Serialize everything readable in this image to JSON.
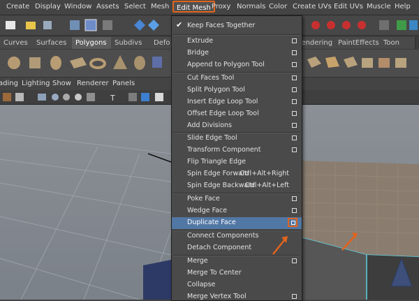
{
  "menubar": [
    "Create",
    "Display",
    "Window",
    "Assets",
    "Select",
    "Mesh",
    "Edit Mesh",
    "Proxy",
    "Normals",
    "Color",
    "Create UVs",
    "Edit UVs",
    "Muscle",
    "Help"
  ],
  "tabs": [
    "Curves",
    "Surfaces",
    "Polygons",
    "Subdivs",
    "Defo",
    "Rendering",
    "PaintEffects",
    "Toon"
  ],
  "panel_menus": [
    "ading",
    "Lighting",
    "Show",
    "Renderer",
    "Panels"
  ],
  "edit_mesh_menu": {
    "items": [
      {
        "label": "Keep Faces Together",
        "checked": true
      },
      {
        "label": "Extrude",
        "option_box": true
      },
      {
        "label": "Bridge",
        "option_box": true
      },
      {
        "label": "Append to Polygon Tool",
        "option_box": true
      },
      {
        "label": "Cut Faces Tool",
        "option_box": true
      },
      {
        "label": "Split Polygon Tool",
        "option_box": true
      },
      {
        "label": "Insert Edge Loop Tool",
        "option_box": true
      },
      {
        "label": "Offset Edge Loop Tool",
        "option_box": true
      },
      {
        "label": "Add Divisions",
        "option_box": true
      },
      {
        "label": "Slide Edge Tool",
        "option_box": true
      },
      {
        "label": "Transform Component",
        "option_box": true
      },
      {
        "label": "Flip Triangle Edge"
      },
      {
        "label": "Spin Edge Forward",
        "shortcut": "Ctrl+Alt+Right"
      },
      {
        "label": "Spin Edge Backward",
        "shortcut": "Ctrl+Alt+Left"
      },
      {
        "label": "Poke Face",
        "option_box": true
      },
      {
        "label": "Wedge Face",
        "option_box": true
      },
      {
        "label": "Duplicate Face",
        "option_box": true,
        "highlighted": true
      },
      {
        "label": "Connect Components"
      },
      {
        "label": "Detach Component"
      },
      {
        "label": "Merge",
        "option_box": true
      },
      {
        "label": "Merge To Center"
      },
      {
        "label": "Collapse"
      },
      {
        "label": "Merge Vertex Tool",
        "option_box": true
      }
    ]
  },
  "colors": {
    "highlight": "#5177a4",
    "annotation": "#e1641d"
  }
}
